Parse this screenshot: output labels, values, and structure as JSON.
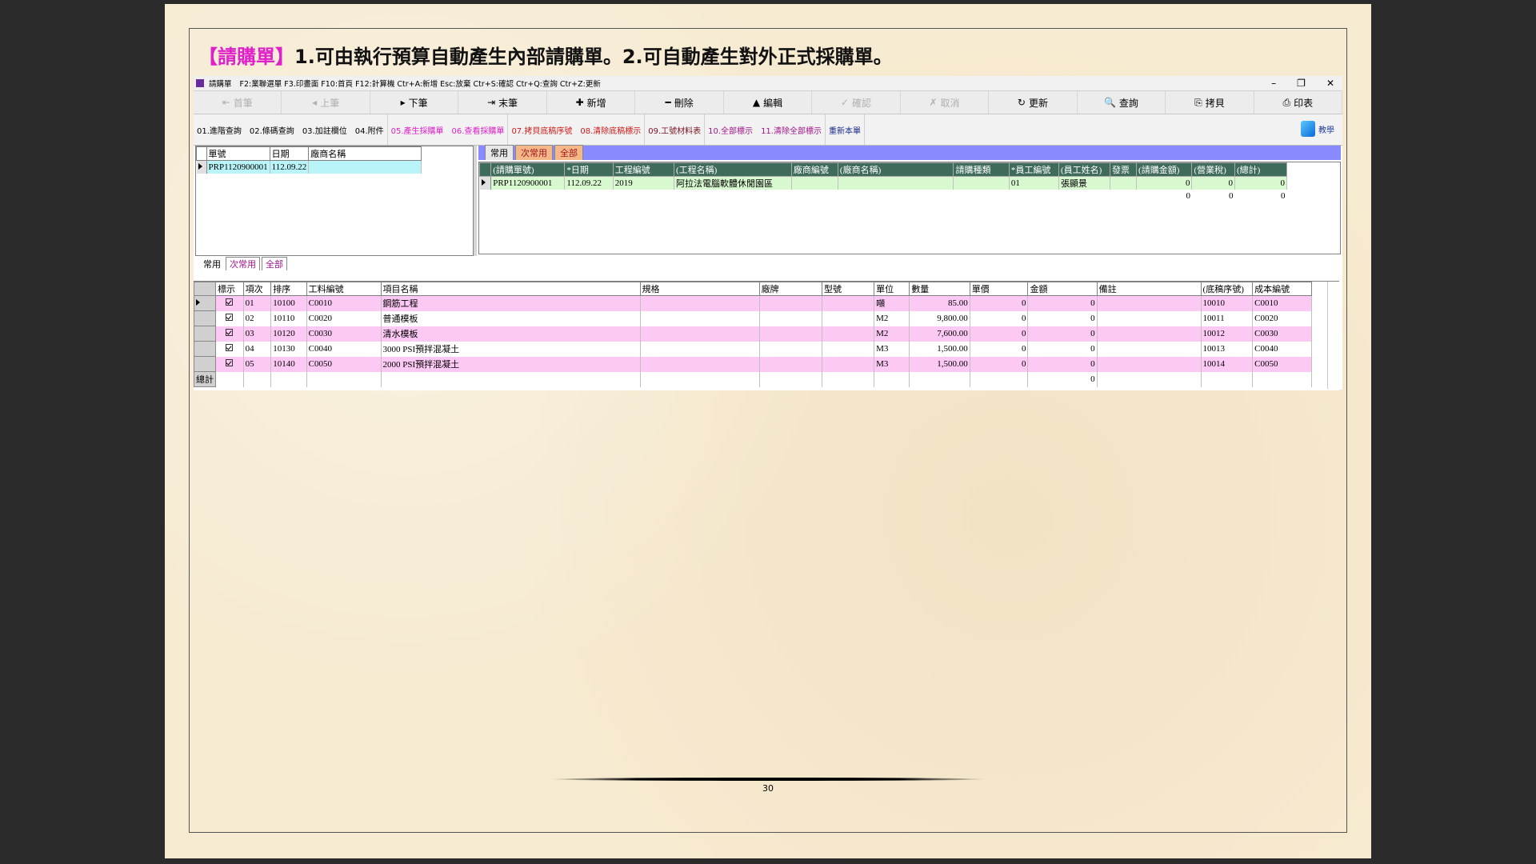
{
  "slide": {
    "title_tag": "【請購單】",
    "title_text": "1.可由執行預算自動產生內部請購單。2.可自動產生對外正式採購單。",
    "page_number": "30"
  },
  "window": {
    "title": "請購單",
    "shortcuts": "F2:業聯選單  F3.印畫面  F10:首頁  F12:計算機  Ctr+A:新增  Esc:放棄  Ctr+S:確認  Ctr+Q:查詢  Ctr+Z:更新",
    "min": "–",
    "max": "❐",
    "close": "✕"
  },
  "toolbar": [
    {
      "icon": "⇤",
      "label": "首筆",
      "disabled": true
    },
    {
      "icon": "◂",
      "label": "上筆",
      "disabled": true
    },
    {
      "icon": "▸",
      "label": "下筆",
      "disabled": false
    },
    {
      "icon": "⇥",
      "label": "末筆",
      "disabled": false
    },
    {
      "icon": "✚",
      "label": "新增",
      "disabled": false
    },
    {
      "icon": "━",
      "label": "刪除",
      "disabled": false
    },
    {
      "icon": "▲",
      "label": "編輯",
      "disabled": false
    },
    {
      "icon": "✓",
      "label": "確認",
      "disabled": true
    },
    {
      "icon": "✗",
      "label": "取消",
      "disabled": true
    },
    {
      "icon": "↻",
      "label": "更新",
      "disabled": false
    },
    {
      "icon": "🔍",
      "label": "查詢",
      "disabled": false
    },
    {
      "icon": "⎘",
      "label": "拷貝",
      "disabled": false
    },
    {
      "icon": "⎙",
      "label": "印表",
      "disabled": false
    }
  ],
  "funcbar": {
    "g1": [
      "01.進階查詢",
      "02.條碼查詢",
      "03.加註欄位",
      "04.附件"
    ],
    "g2": [
      "05.產生採購單",
      "06.查看採購單"
    ],
    "g3": [
      "07.拷貝底稿序號",
      "08.清除底稿標示"
    ],
    "g4": [
      "09.工號材料表"
    ],
    "g5": [
      "10.全部標示",
      "11.清除全部標示"
    ],
    "g6": [
      "重新本單"
    ],
    "help": "教學",
    "colors": {
      "g1": "#000000",
      "g2": "#e020c8",
      "g3": "#d01818",
      "g4": "#7a1020",
      "g5": "#a0148a",
      "g6": "#1a2a8a"
    }
  },
  "left_grid": {
    "headers": [
      "單號",
      "日期",
      "廠商名稱"
    ],
    "rows": [
      [
        "PRP1120900001",
        "112.09.22",
        ""
      ]
    ]
  },
  "right_tabs": [
    "常用",
    "次常用",
    "全部"
  ],
  "right_grid": {
    "headers": [
      "(請購單號)",
      "*日期",
      "工程編號",
      "(工程名稱)",
      "廠商編號",
      "(廠商名稱)",
      "請購種類",
      "*員工編號",
      "(員工姓名)",
      "發票",
      "(請購金額)",
      "(營業稅)",
      "(總計)"
    ],
    "rows": [
      [
        "PRP1120900001",
        "112.09.22",
        "2019",
        "阿拉法電腦軟體休閒園區",
        "",
        "",
        "",
        "01",
        "張顯景",
        "",
        "0",
        "0",
        "0"
      ]
    ],
    "totals": [
      "0",
      "0",
      "0"
    ]
  },
  "bottom_tabs": [
    "常用",
    "次常用",
    "全部"
  ],
  "detail_grid": {
    "headers": [
      "標示",
      "項次",
      "排序",
      "工料編號",
      "項目名稱",
      "規格",
      "廠牌",
      "型號",
      "單位",
      "數量",
      "單價",
      "金額",
      "備註",
      "(底稿序號)",
      "成本編號"
    ],
    "rows": [
      [
        "01",
        "10100",
        "C0010",
        "鋼筋工程",
        "",
        "",
        "",
        "噸",
        "85.00",
        "0",
        "0",
        "",
        "10010",
        "C0010"
      ],
      [
        "02",
        "10110",
        "C0020",
        "普通模板",
        "",
        "",
        "",
        "M2",
        "9,800.00",
        "0",
        "0",
        "",
        "10011",
        "C0020"
      ],
      [
        "03",
        "10120",
        "C0030",
        "清水模板",
        "",
        "",
        "",
        "M2",
        "7,600.00",
        "0",
        "0",
        "",
        "10012",
        "C0030"
      ],
      [
        "04",
        "10130",
        "C0040",
        "3000 PSI預拌混凝土",
        "",
        "",
        "",
        "M3",
        "1,500.00",
        "0",
        "0",
        "",
        "10013",
        "C0040"
      ],
      [
        "05",
        "10140",
        "C0050",
        "2000 PSI預拌混凝土",
        "",
        "",
        "",
        "M3",
        "1,500.00",
        "0",
        "0",
        "",
        "10014",
        "C0050"
      ]
    ],
    "total_label": "總計",
    "total_amount": "0"
  }
}
